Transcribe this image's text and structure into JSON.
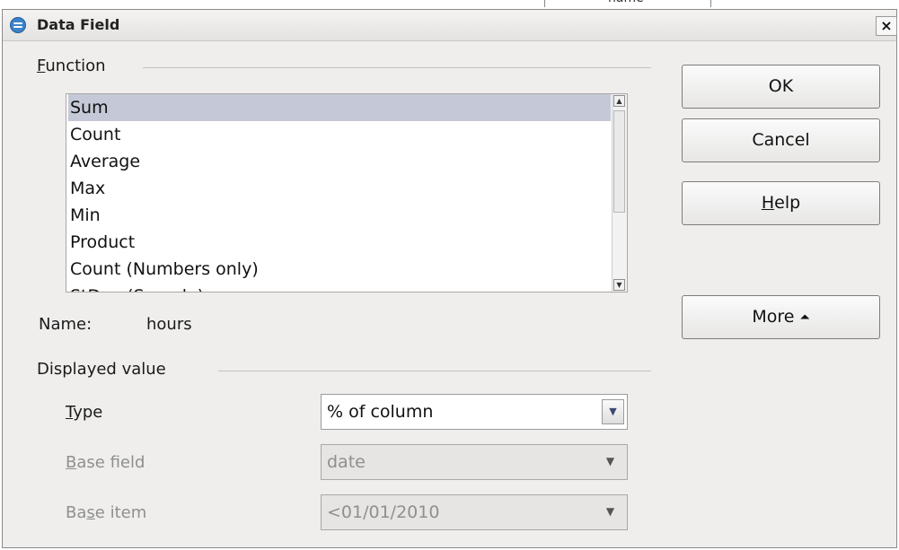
{
  "background": {
    "fragment_text": "name"
  },
  "dialog": {
    "title": "Data Field",
    "close_glyph": "×"
  },
  "function_section": {
    "label_underlined": "F",
    "label_rest": "unction",
    "items": [
      {
        "label": "Sum",
        "selected": true
      },
      {
        "label": "Count"
      },
      {
        "label": "Average"
      },
      {
        "label": "Max"
      },
      {
        "label": "Min"
      },
      {
        "label": "Product"
      },
      {
        "label": "Count (Numbers only)"
      },
      {
        "label": "StDev (Sample)"
      }
    ]
  },
  "name": {
    "label": "Name:",
    "value": "hours"
  },
  "displayed_value": {
    "label": "Displayed value",
    "type": {
      "label_underlined": "T",
      "label_rest": "ype",
      "value": "% of column"
    },
    "base_field": {
      "label_underlined": "B",
      "label_rest": "ase field",
      "value": "date"
    },
    "base_item": {
      "label_pre": "Ba",
      "label_underlined": "s",
      "label_rest": "e item",
      "value": "<01/01/2010"
    }
  },
  "buttons": {
    "ok": "OK",
    "cancel": "Cancel",
    "help_underlined": "H",
    "help_rest": "elp",
    "more": "More"
  },
  "colors": {
    "dialog_bg": "#efeeed",
    "selection": "#c5c8d6",
    "icon_blue": "#3c83c9"
  },
  "icons": {
    "scroll_up": "▲",
    "scroll_down": "▼",
    "dropdown": "▼",
    "more_arrow": "⏶"
  }
}
